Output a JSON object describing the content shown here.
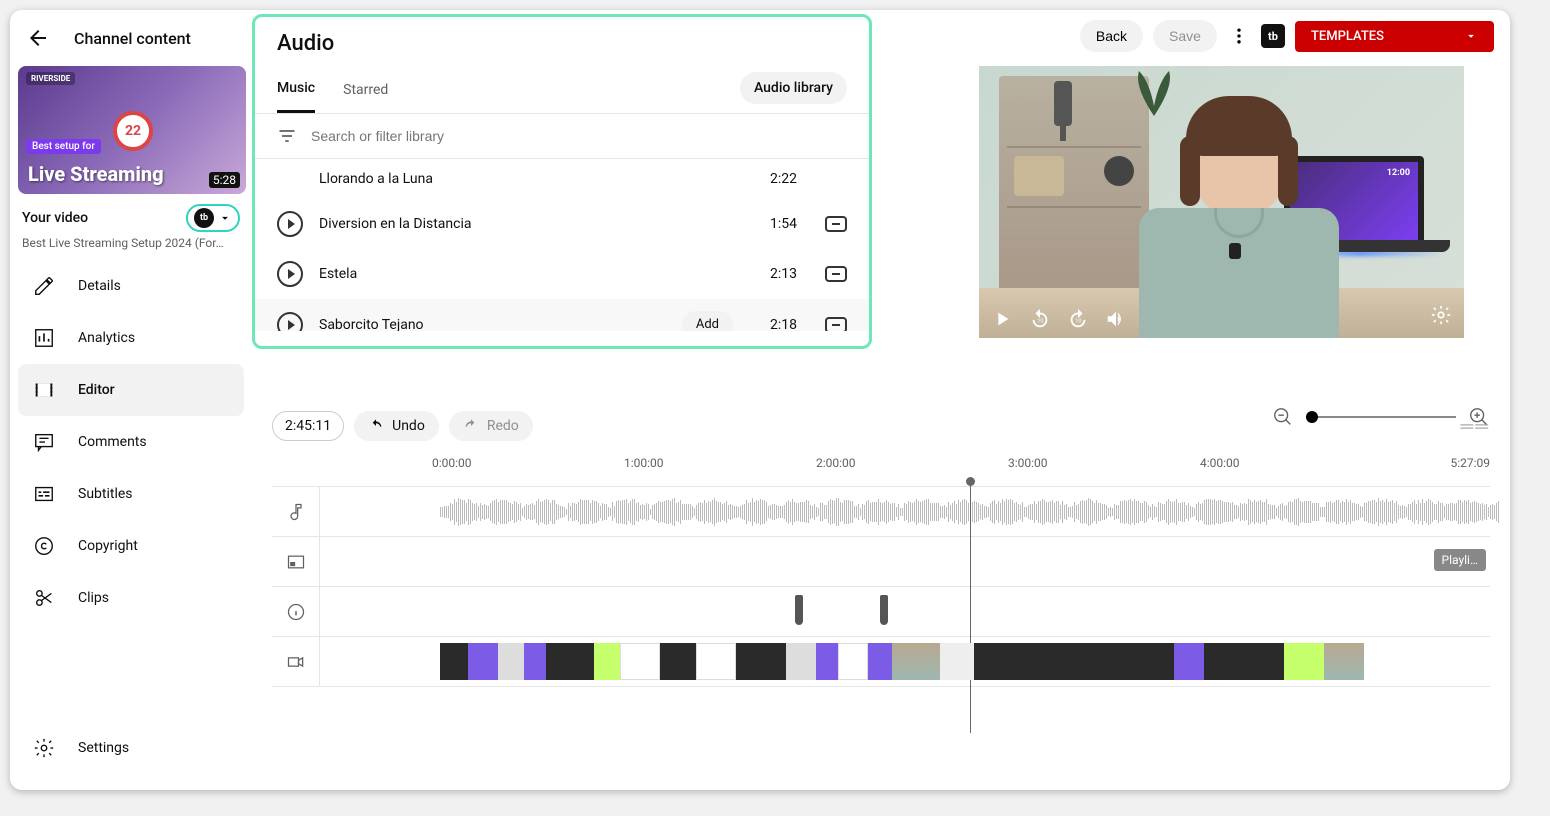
{
  "header": {
    "page_title": "Channel content",
    "back": "Back",
    "save": "Save",
    "templates": "TEMPLATES"
  },
  "sidebar": {
    "your_video": "Your video",
    "video_title": "Best Live Streaming Setup 2024 (For…",
    "thumb_badge": "Best setup for",
    "thumb_text": "Live Streaming",
    "thumb_rs_label": "RIVERSIDE",
    "thumb_circle": "22",
    "thumb_duration": "5:28",
    "nav": {
      "details": "Details",
      "analytics": "Analytics",
      "editor": "Editor",
      "comments": "Comments",
      "subtitles": "Subtitles",
      "copyright": "Copyright",
      "clips": "Clips",
      "settings": "Settings"
    }
  },
  "audio_panel": {
    "title": "Audio",
    "tabs": {
      "music": "Music",
      "starred": "Starred"
    },
    "library_btn": "Audio library",
    "search_placeholder": "Search or filter library",
    "add_label": "Add",
    "tracks": [
      {
        "name": "Llorando a la Luna",
        "duration": "2:22"
      },
      {
        "name": "Diversion en la Distancia",
        "duration": "1:54"
      },
      {
        "name": "Estela",
        "duration": "2:13"
      },
      {
        "name": "Saborcito Tejano",
        "duration": "2:18"
      }
    ]
  },
  "preview": {
    "laptop_time": "12:00"
  },
  "timeline": {
    "current_time": "2:45:11",
    "undo": "Undo",
    "redo": "Redo",
    "playlist_tag": "Playli…",
    "ruler": [
      "0:00:00",
      "1:00:00",
      "2:00:00",
      "3:00:00",
      "4:00:00",
      "5:27:09"
    ]
  }
}
